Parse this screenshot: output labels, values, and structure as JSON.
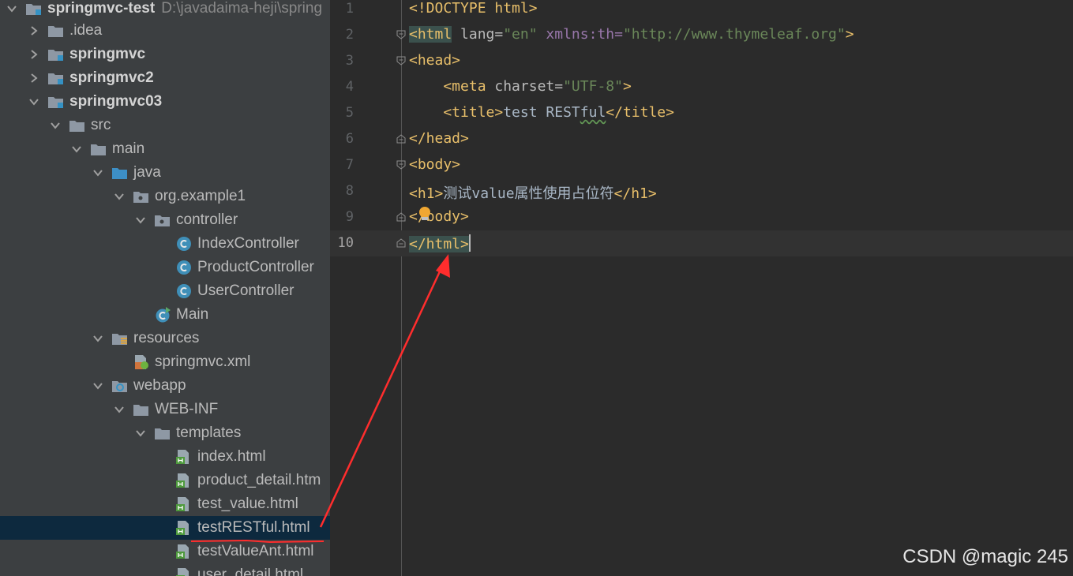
{
  "project_tree": {
    "root": {
      "name": "springmvc-test",
      "path": "D:\\javadaima-heji\\spring"
    },
    "items": [
      {
        "label": "springmvc-test",
        "icon": "module-folder-icon"
      },
      {
        "label": ".idea",
        "icon": "folder-icon"
      },
      {
        "label": "springmvc",
        "icon": "module-folder-icon"
      },
      {
        "label": "springmvc2",
        "icon": "module-folder-icon"
      },
      {
        "label": "springmvc03",
        "icon": "module-folder-icon"
      },
      {
        "label": "src",
        "icon": "folder-icon"
      },
      {
        "label": "main",
        "icon": "folder-icon"
      },
      {
        "label": "java",
        "icon": "source-folder-icon"
      },
      {
        "label": "org.example1",
        "icon": "package-icon"
      },
      {
        "label": "controller",
        "icon": "package-icon"
      },
      {
        "label": "IndexController",
        "icon": "java-class-icon"
      },
      {
        "label": "ProductController",
        "icon": "java-class-icon"
      },
      {
        "label": "UserController",
        "icon": "java-class-icon"
      },
      {
        "label": "Main",
        "icon": "java-main-class-icon"
      },
      {
        "label": "resources",
        "icon": "resources-folder-icon"
      },
      {
        "label": "springmvc.xml",
        "icon": "spring-xml-icon"
      },
      {
        "label": "webapp",
        "icon": "web-folder-icon"
      },
      {
        "label": "WEB-INF",
        "icon": "folder-icon"
      },
      {
        "label": "templates",
        "icon": "folder-icon"
      },
      {
        "label": "index.html",
        "icon": "html-file-icon"
      },
      {
        "label": "product_detail.htm",
        "icon": "html-file-icon"
      },
      {
        "label": "test_value.html",
        "icon": "html-file-icon"
      },
      {
        "label": "testRESTful.html",
        "icon": "html-file-icon"
      },
      {
        "label": "testValueAnt.html",
        "icon": "html-file-icon"
      },
      {
        "label": "user_detail.html",
        "icon": "html-file-icon"
      }
    ],
    "selected": "testRESTful.html"
  },
  "editor": {
    "line_numbers": [
      "1",
      "2",
      "3",
      "4",
      "5",
      "6",
      "7",
      "8",
      "9",
      "10"
    ],
    "current_line": "10",
    "lines": {
      "l1": {
        "a": "<!DOCTYPE html>"
      },
      "l2": {
        "a": "<html",
        "b": " lang=",
        "c": "\"en\"",
        "d": " xmlns:th=",
        "e": "\"http://www.thymeleaf.org\"",
        "f": ">"
      },
      "l3": {
        "a": "<head>"
      },
      "l4": {
        "a": "    <meta",
        "b": " charset=",
        "c": "\"UTF-8\"",
        "d": ">"
      },
      "l5": {
        "a": "    <title>",
        "b": "test REST",
        "c": "ful",
        "d": "</title>"
      },
      "l6": {
        "a": "</head>"
      },
      "l7": {
        "a": "<body>"
      },
      "l8": {
        "a": "<h1>",
        "b": "测试",
        "c": "value",
        "d": "属性使用占位符",
        "e": "</h1>"
      },
      "l9": {
        "a": "</body>"
      },
      "l10": {
        "a": "</html>"
      }
    }
  },
  "colors": {
    "tag": "#e8bf6a",
    "string": "#6a8759",
    "attribute": "#bababa",
    "arrow": "#ff2d2d"
  },
  "watermark": "CSDN @magic 245"
}
